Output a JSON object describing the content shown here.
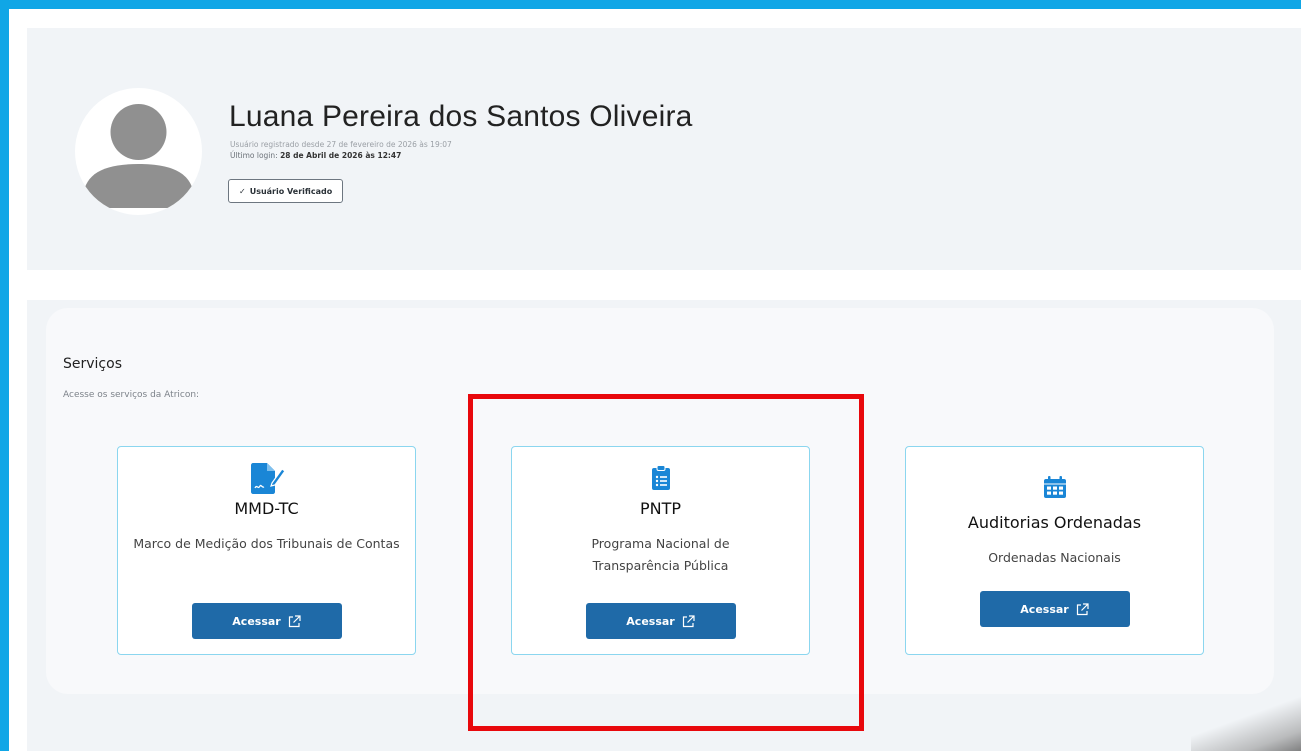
{
  "profile": {
    "name": "Luana Pereira dos Santos Oliveira",
    "registered": "Usuário registrado desde 27 de fevereiro de 2026 às 19:07",
    "last_login_label": "Último login: ",
    "last_login_value": "28 de Abril de 2026 às 12:47",
    "verified_badge": "Usuário Verificado"
  },
  "services": {
    "title": "Serviços",
    "subtitle": "Acesse os serviços da Atricon:",
    "items": [
      {
        "title": "MMD-TC",
        "description": "Marco de Medição dos Tribunais de Contas",
        "button": "Acessar",
        "icon": "file-signature-icon"
      },
      {
        "title": "PNTP",
        "description": "Programa Nacional de Transparência Pública",
        "button": "Acessar",
        "icon": "clipboard-list-icon"
      },
      {
        "title": "Auditorias Ordenadas",
        "description": "Ordenadas Nacionais",
        "button": "Acessar",
        "icon": "calendar-icon"
      }
    ]
  },
  "colors": {
    "frame": "#10a6e6",
    "button": "#1f6aa8",
    "icon": "#1a86d6",
    "card_border": "#8bd6ef",
    "highlight": "#e8080c"
  }
}
